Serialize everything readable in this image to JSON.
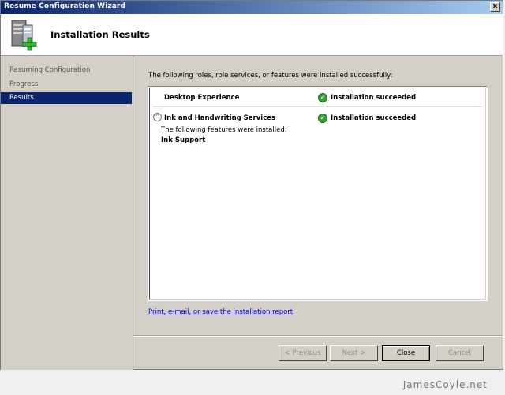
{
  "window": {
    "title": "Resume Configuration Wizard",
    "close_label": "x"
  },
  "header": {
    "title": "Installation Results",
    "icon": "server-add-icon"
  },
  "sidebar": {
    "items": [
      {
        "label": "Resuming Configuration",
        "active": false
      },
      {
        "label": "Progress",
        "active": false
      },
      {
        "label": "Results",
        "active": true
      }
    ]
  },
  "main": {
    "intro": "The following roles, role services, or features were installed successfully:",
    "results": [
      {
        "name": "Desktop Experience",
        "status": "Installation succeeded",
        "status_icon": "check-icon"
      },
      {
        "name": "Ink and Handwriting Services",
        "status": "Installation succeeded",
        "status_icon": "check-icon",
        "detail_label": "The following features were installed:",
        "detail_item": "Ink Support"
      }
    ],
    "report_link": "Print, e-mail, or save the installation report"
  },
  "buttons": {
    "previous": "< Previous",
    "next": "Next >",
    "close": "Close",
    "cancel": "Cancel"
  },
  "watermark": "JamesCoyle.net",
  "colors": {
    "titlebar_start": "#0a246a",
    "selection": "#0a246a",
    "success": "#3aa13a",
    "link": "#0000ee"
  }
}
